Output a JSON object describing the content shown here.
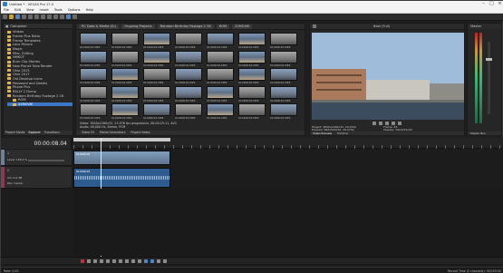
{
  "window": {
    "title": "Untitled * - VEGAS Pro 17.0"
  },
  "menu": [
    "File",
    "Edit",
    "View",
    "Insert",
    "Tools",
    "Options",
    "Help"
  ],
  "explorer": {
    "tabs": [
      "Project Media",
      "Explorer",
      "Transitions"
    ],
    "breadcrumb": "Computer",
    "items": [
      "Videos",
      "Frame Plus Ratio",
      "Frame Templates",
      "Lens Picture",
      "Magic",
      "Misc. Editing",
      "NMKCP",
      "Burn Clip Stories",
      "New Planet Tube Render",
      "Ohio 2013",
      "Ohio 2017",
      "Old Desktop Icons",
      "Password and Details",
      "Phone Pics",
      "RALLY 2 Dump",
      "Random Birthday Footage 2 28",
      "ROM",
      "22MOVIE"
    ],
    "selected_index": 17
  },
  "media": {
    "tabs": [
      "PC Data & Media (D:)",
      "Ongoing Projects",
      "Random Birthday Footage 2 28",
      "ROM",
      "22MOVIE"
    ],
    "thumb_label": "01090016.MP4",
    "info_line1": "Video: 3840x2160x32, 23.976 fps progressive, 00:00:25;11, AVC",
    "info_line2": "Audio: 48,000 Hz, Stereo, PCM",
    "bottom_tabs": [
      "Video FX",
      "Media Generators",
      "Project Notes"
    ]
  },
  "preview": {
    "mode": "Best (Full)",
    "project_label": "Project:",
    "project_value": "3840x2160x32, 29.970p",
    "preview_label": "Preview:",
    "preview_value": "960x540x32, 29.970p",
    "frame_label": "Frame:",
    "frame_value": "46",
    "display_label": "Display:",
    "display_value": "392x221x32",
    "tabs": [
      "Video Preview",
      "Trimmer"
    ]
  },
  "master": {
    "label": "Master",
    "bus_label": "Master Bus"
  },
  "timeline": {
    "timecode": "00:00:08.04",
    "ruler_labels": [
      "00:00:00",
      "00:00:05",
      "00:00:10",
      "00:00:15",
      "00:00:20",
      "00:00:25",
      "00:00:30",
      "00:00:35",
      "00:00:40"
    ],
    "video_track": {
      "number": "1",
      "level": "Level: 100.0 %"
    },
    "audio_track": {
      "number": "2",
      "vol": "Vol:",
      "vol_value": "0.0 dB",
      "pan": "Pan:",
      "pan_value": "Center"
    },
    "clip_label": "01090016",
    "rate": "Rate: 0.00"
  },
  "status": {
    "right": "Record Time (2 channels): 343:55:00"
  },
  "colors": {
    "accent": "#3d76c4",
    "folder": "#e0b64a",
    "video_track": "#6d7f99",
    "audio_track": "#8a3b54"
  }
}
